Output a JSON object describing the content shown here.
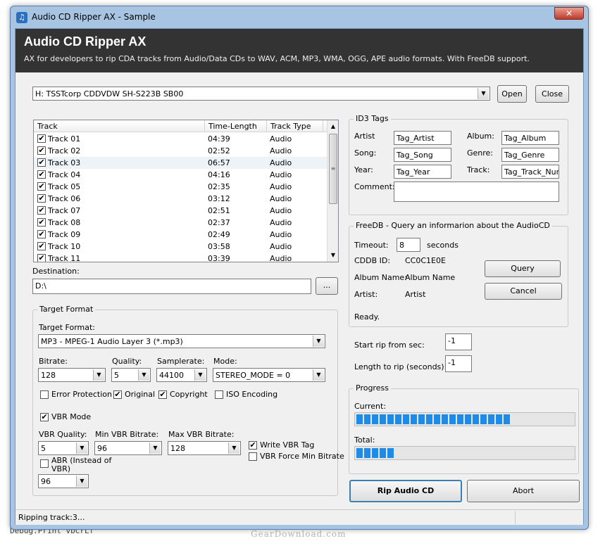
{
  "window": {
    "title": "Audio CD Ripper AX - Sample",
    "close_glyph": "✕"
  },
  "header": {
    "title": "Audio CD Ripper AX",
    "subtitle": "AX for developers to rip CDA tracks from Audio/Data CDs to WAV, ACM, MP3, WMA, OGG, APE audio formats. With FreeDB support."
  },
  "drive": {
    "selected": "H: TSSTcorp CDDVDW SH-S223B  SB00",
    "open_label": "Open",
    "close_label": "Close"
  },
  "tracks": {
    "columns": [
      "Track",
      "Time-Length",
      "Track Type"
    ],
    "rows": [
      {
        "name": "Track 01",
        "time": "04:39",
        "type": "Audio",
        "checked": true
      },
      {
        "name": "Track 02",
        "time": "02:52",
        "type": "Audio",
        "checked": true
      },
      {
        "name": "Track 03",
        "time": "06:57",
        "type": "Audio",
        "checked": true
      },
      {
        "name": "Track 04",
        "time": "04:16",
        "type": "Audio",
        "checked": true
      },
      {
        "name": "Track 05",
        "time": "02:35",
        "type": "Audio",
        "checked": true
      },
      {
        "name": "Track 06",
        "time": "03:12",
        "type": "Audio",
        "checked": true
      },
      {
        "name": "Track 07",
        "time": "02:51",
        "type": "Audio",
        "checked": true
      },
      {
        "name": "Track 08",
        "time": "02:37",
        "type": "Audio",
        "checked": true
      },
      {
        "name": "Track 09",
        "time": "02:49",
        "type": "Audio",
        "checked": true
      },
      {
        "name": "Track 10",
        "time": "03:58",
        "type": "Audio",
        "checked": true
      },
      {
        "name": "Track 11",
        "time": "03:39",
        "type": "Audio",
        "checked": true
      }
    ]
  },
  "destination": {
    "label": "Destination:",
    "value": "D:\\",
    "browse_label": "..."
  },
  "id3": {
    "group_title": "ID3 Tags",
    "artist_label": "Artist",
    "artist_value": "Tag_Artist",
    "album_label": "Album:",
    "album_value": "Tag_Album",
    "song_label": "Song:",
    "song_value": "Tag_Song",
    "genre_label": "Genre:",
    "genre_value": "Tag_Genre",
    "year_label": "Year:",
    "year_value": "Tag_Year",
    "track_label": "Track:",
    "track_value": "Tag_Track_Num",
    "comment_label": "Comment:",
    "comment_value": ""
  },
  "freedb": {
    "group_title": "FreeDB - Query an informarion about the AudioCD",
    "timeout_label": "Timeout:",
    "timeout_value": "8",
    "seconds_label": "seconds",
    "cddb_label": "CDDB ID:",
    "cddb_value": "CC0C1E0E",
    "album_label": "Album Name:",
    "album_value": "Album Name",
    "artist_label": "Artist:",
    "artist_value": "Artist",
    "status": "Ready.",
    "query_label": "Query",
    "cancel_label": "Cancel"
  },
  "rip": {
    "start_label": "Start rip from sec:",
    "start_value": "-1",
    "length_label": "Length to rip (seconds):",
    "length_value": "-1"
  },
  "progress": {
    "group_title": "Progress",
    "current_label": "Current:",
    "current_fraction": 0.73,
    "total_label": "Total:",
    "total_fraction": 0.18
  },
  "format": {
    "group_title": "Target Format",
    "format_label": "Target Format:",
    "format_value": "MP3 - MPEG-1 Audio Layer 3 (*.mp3)",
    "bitrate_label": "Bitrate:",
    "bitrate_value": "128",
    "quality_label": "Quality:",
    "quality_value": "5",
    "samplerate_label": "Samplerate:",
    "samplerate_value": "44100",
    "mode_label": "Mode:",
    "mode_value": "STEREO_MODE = 0",
    "error_protection": {
      "label": "Error Protection",
      "checked": false
    },
    "original": {
      "label": "Original",
      "checked": true
    },
    "copyright": {
      "label": "Copyright",
      "checked": true
    },
    "iso_encoding": {
      "label": "ISO Encoding",
      "checked": false
    },
    "vbr_mode": {
      "label": "VBR Mode",
      "checked": true
    },
    "vbr_quality_label": "VBR Quality:",
    "vbr_quality_value": "5",
    "min_vbr_label": "Min VBR Bitrate:",
    "min_vbr_value": "96",
    "max_vbr_label": "Max VBR Bitrate:",
    "max_vbr_value": "128",
    "write_vbr_tag": {
      "label": "Write VBR Tag",
      "checked": true
    },
    "vbr_force_min": {
      "label": "VBR Force Min Bitrate",
      "checked": false
    },
    "abr": {
      "label_line1": "ABR (Instead of",
      "label_line2": "VBR)",
      "checked": false
    },
    "abr_value": "96"
  },
  "actions": {
    "rip_label": "Rip Audio CD",
    "abort_label": "Abort"
  },
  "status_bar": {
    "text": "Ripping track:3..."
  },
  "background": {
    "code_line": "Debug.Print vbCrLf",
    "watermark": "GearDownload.com"
  }
}
